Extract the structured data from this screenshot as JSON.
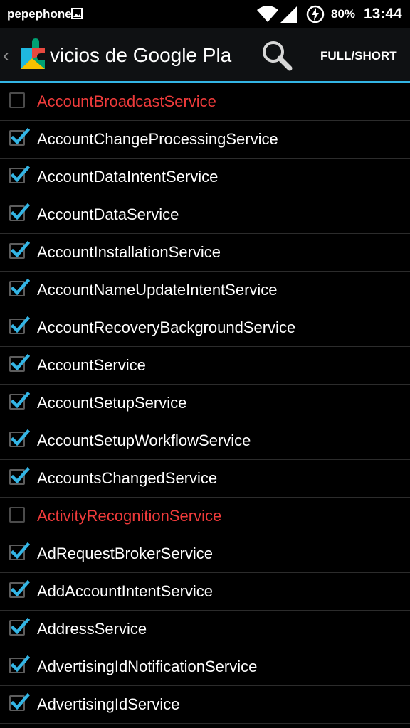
{
  "status_bar": {
    "carrier": "pepephone",
    "battery": "80%",
    "time": "13:44",
    "icons": [
      "image-icon",
      "wifi-icon",
      "signal-icon",
      "battery-charging-icon"
    ]
  },
  "action_bar": {
    "title": "Servicios de Google Play",
    "visible_title": "vicios de Google Pla",
    "toggle_label": "FULL/SHORT",
    "icons": [
      "back-chevron-icon",
      "google-play-services-icon",
      "search-icon"
    ]
  },
  "colors": {
    "accent": "#33b5e5",
    "disabled_text": "#ef3b3b",
    "enabled_text": "#ffffff",
    "check": "#33b5e5"
  },
  "services": [
    {
      "name": "AccountBroadcastService",
      "checked": false
    },
    {
      "name": "AccountChangeProcessingService",
      "checked": true
    },
    {
      "name": "AccountDataIntentService",
      "checked": true
    },
    {
      "name": "AccountDataService",
      "checked": true
    },
    {
      "name": "AccountInstallationService",
      "checked": true
    },
    {
      "name": "AccountNameUpdateIntentService",
      "checked": true
    },
    {
      "name": "AccountRecoveryBackgroundService",
      "checked": true
    },
    {
      "name": "AccountService",
      "checked": true
    },
    {
      "name": "AccountSetupService",
      "checked": true
    },
    {
      "name": "AccountSetupWorkflowService",
      "checked": true
    },
    {
      "name": "AccountsChangedService",
      "checked": true
    },
    {
      "name": "ActivityRecognitionService",
      "checked": false
    },
    {
      "name": "AdRequestBrokerService",
      "checked": true
    },
    {
      "name": "AddAccountIntentService",
      "checked": true
    },
    {
      "name": "AddressService",
      "checked": true
    },
    {
      "name": "AdvertisingIdNotificationService",
      "checked": true
    },
    {
      "name": "AdvertisingIdService",
      "checked": true
    }
  ]
}
